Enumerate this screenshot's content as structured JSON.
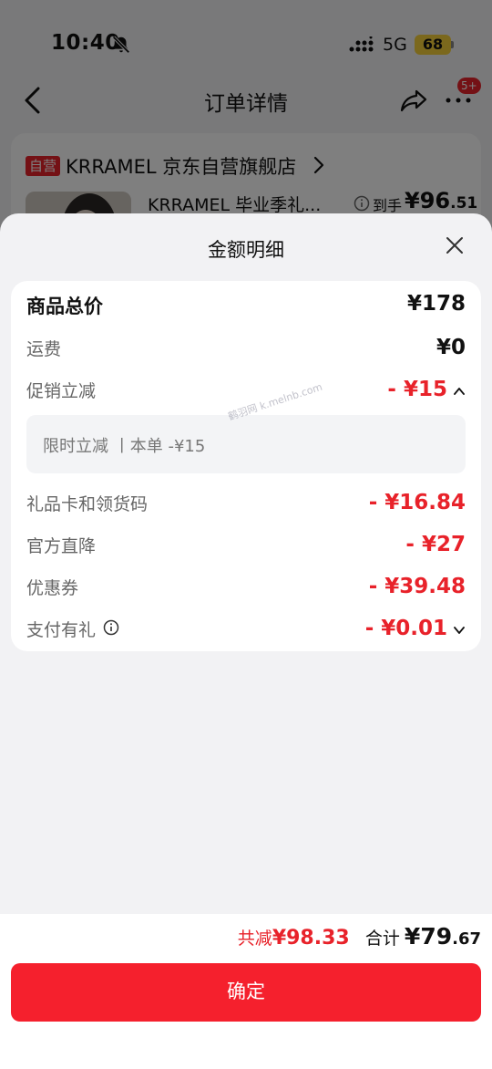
{
  "status_bar": {
    "time": "10:40",
    "network": "5G",
    "battery": "68"
  },
  "nav": {
    "title": "订单详情",
    "badge": "5+"
  },
  "store": {
    "tag": "自营",
    "name": "KRRAMEL 京东自营旗舰店",
    "product_name": "KRRAMEL 毕业季礼...",
    "price_label": "到手",
    "price_main": "¥96",
    "price_decimal": ".51"
  },
  "sheet": {
    "title": "金额明细",
    "rows": [
      {
        "label": "商品总价",
        "value": "¥178"
      },
      {
        "label": "运费",
        "value": "¥0"
      },
      {
        "label": "促销立减",
        "value": "- ¥15"
      },
      {
        "label": "礼品卡和领货码",
        "value": "- ¥16.84"
      },
      {
        "label": "官方直降",
        "value": "- ¥27"
      },
      {
        "label": "优惠券",
        "value": "- ¥39.48"
      },
      {
        "label": "支付有礼",
        "value": "- ¥0.01"
      }
    ],
    "promo_detail": "限时立减 丨本单 -¥15"
  },
  "watermark": "鹤羽网 k.melnb.com",
  "footer": {
    "saved_label": "共减",
    "saved_value": "¥98.33",
    "total_label": "合计",
    "total_main": "¥79",
    "total_decimal": ".67",
    "confirm_label": "确定"
  },
  "colors": {
    "accent": "#e8222a",
    "button": "#f5202d",
    "battery": "#f7d13a"
  }
}
